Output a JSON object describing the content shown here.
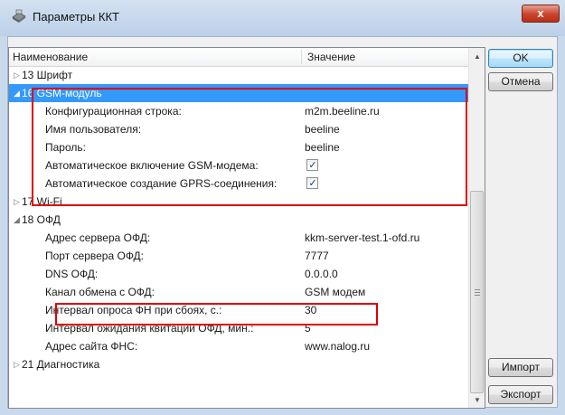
{
  "window": {
    "title": "Параметры ККТ",
    "close_symbol": "x"
  },
  "grid": {
    "columns": {
      "name": "Наименование",
      "value": "Значение"
    },
    "rows": [
      {
        "exp": "▷",
        "name": "13 Шрифт",
        "value": "",
        "checkbox": false
      },
      {
        "exp": "◢",
        "name": "16 GSM-модуль",
        "value": "",
        "checkbox": false,
        "selected": true
      },
      {
        "exp": "",
        "name": "Конфигурационная строка:",
        "value": "m2m.beeline.ru",
        "checkbox": false
      },
      {
        "exp": "",
        "name": "Имя пользователя:",
        "value": "beeline",
        "checkbox": false
      },
      {
        "exp": "",
        "name": "Пароль:",
        "value": "beeline",
        "checkbox": false
      },
      {
        "exp": "",
        "name": "Автоматическое включение GSM-модема:",
        "value": "",
        "checkbox": true,
        "checked": true
      },
      {
        "exp": "",
        "name": "Автоматическое создание GPRS-соединения:",
        "value": "",
        "checkbox": true,
        "checked": true
      },
      {
        "exp": "▷",
        "name": "17 Wi-Fi",
        "value": "",
        "checkbox": false
      },
      {
        "exp": "◢",
        "name": "18 ОФД",
        "value": "",
        "checkbox": false
      },
      {
        "exp": "",
        "name": "Адрес сервера ОФД:",
        "value": "kkm-server-test.1-ofd.ru",
        "checkbox": false
      },
      {
        "exp": "",
        "name": "Порт сервера ОФД:",
        "value": "7777",
        "checkbox": false
      },
      {
        "exp": "",
        "name": "DNS ОФД:",
        "value": "0.0.0.0",
        "checkbox": false
      },
      {
        "exp": "",
        "name": "Канал обмена с ОФД:",
        "value": "GSM модем",
        "checkbox": false
      },
      {
        "exp": "",
        "name": "Интервал опроса ФН при сбоях, с.:",
        "value": "30",
        "checkbox": false
      },
      {
        "exp": "",
        "name": "Интервал ожидания квитации ОФД, мин.:",
        "value": "5",
        "checkbox": false
      },
      {
        "exp": "",
        "name": "Адрес сайта ФНС:",
        "value": "www.nalog.ru",
        "checkbox": false
      },
      {
        "exp": "▷",
        "name": "21 Диагностика",
        "value": "",
        "checkbox": false
      }
    ]
  },
  "buttons": {
    "ok": "OK",
    "cancel": "Отмена",
    "import": "Импорт",
    "export": "Экспорт"
  },
  "colors": {
    "selection": "#3399ff",
    "highlight_box": "#e00000"
  }
}
